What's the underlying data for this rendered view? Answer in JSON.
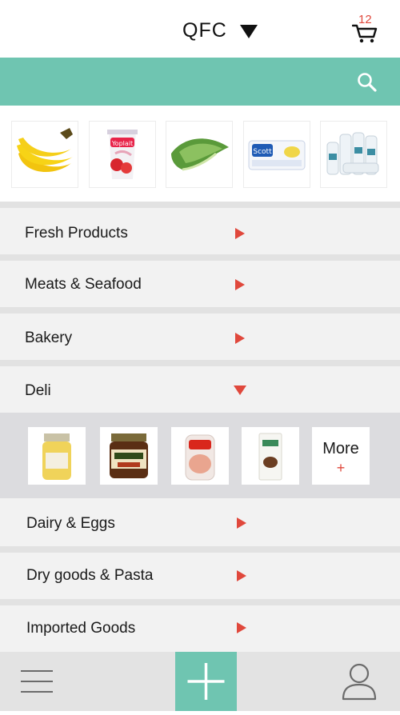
{
  "header": {
    "store_name": "QFC",
    "cart_count": "12"
  },
  "featured": {
    "items": [
      "bananas",
      "yoplait yogurt",
      "romaine lettuce",
      "scott paper towels",
      "dove bottles"
    ]
  },
  "categories": [
    {
      "label": "Fresh Products",
      "state": "collapsed"
    },
    {
      "label": "Meats & Seafood",
      "state": "collapsed"
    },
    {
      "label": "Bakery",
      "state": "collapsed"
    },
    {
      "label": "Deli",
      "state": "expanded"
    },
    {
      "label": "Dairy & Eggs",
      "state": "collapsed"
    },
    {
      "label": "Dry goods & Pasta",
      "state": "collapsed"
    },
    {
      "label": "Imported Goods",
      "state": "collapsed"
    }
  ],
  "deli": {
    "items": [
      "mustard jar",
      "caponata jar",
      "sliced ham package",
      "coffee bag"
    ],
    "more_label": "More",
    "more_plus": "+"
  },
  "colors": {
    "accent": "#6fc5b1",
    "arrow": "#e0483c",
    "row_bg": "#f2f2f2",
    "separator": "#e2e2e2",
    "tray_bg": "#dcdcdf"
  },
  "icons": [
    "cart-icon",
    "search-icon",
    "caret-down-icon",
    "arrow-right-icon",
    "arrow-down-icon",
    "menu-icon",
    "plus-icon",
    "profile-icon"
  ]
}
